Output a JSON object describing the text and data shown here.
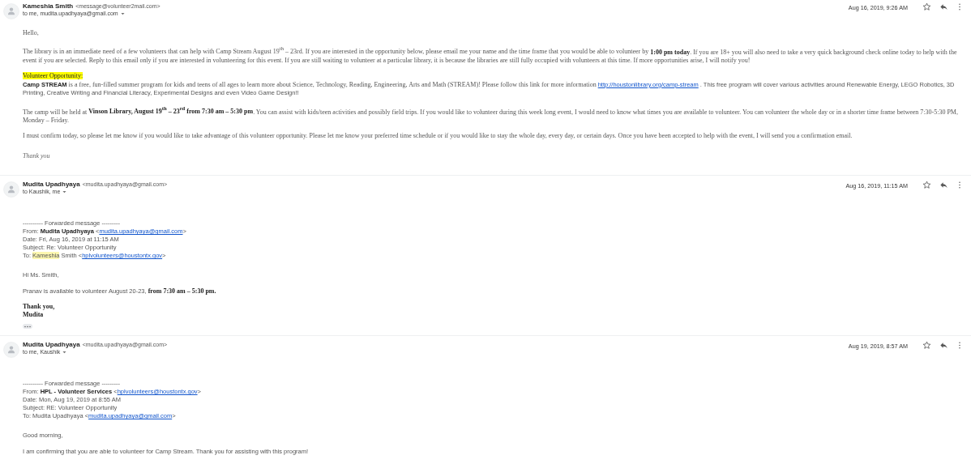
{
  "messages": [
    {
      "sender": "Kameshia Smith",
      "email": "<message@volunteer2mail.com>",
      "to": "to me, mudita.upadhyaya@gmail.com",
      "date": "Aug 16, 2019, 9:26 AM",
      "body": [
        {
          "kind": "para",
          "parts": [
            {
              "kind": "serif",
              "text": "Hello,"
            }
          ]
        },
        {
          "kind": "para",
          "parts": [
            {
              "kind": "serif",
              "text": "The library is in an immediate need of a few volunteers that can help with Camp Stream August 19$^{th}$ – 23rd. If you are interested in the opportunity below, please email me your name and the time frame that you would be able to volunteer by "
            },
            {
              "kind": "serif-strong",
              "text": "1:00 pm today"
            },
            {
              "kind": "serif",
              "text": ". If you are 18+ you will also need to take a very quick background check online today to help with the event if you are selected. Reply to this email only if you are interested in volunteering for this event. If you are still waiting to volunteer at a particular library, it is because the libraries are still fully occupied with volunteers at this time. If more opportunities arise, I will notify you!"
            }
          ]
        },
        {
          "kind": "highlight",
          "parts": [
            {
              "kind": "serif",
              "text": "Volunteer Opportunity:"
            }
          ]
        },
        {
          "kind": "para",
          "parts": [
            {
              "kind": "sans-strong",
              "text": "Camp STREAM"
            },
            {
              "kind": "serif",
              "text": " is a free, fun-filled summer program for kids and teens of all ages to learn more about Science, Technology, Reading, Engineering, Arts and Math (STREAM)! Please follow this link for more information "
            },
            {
              "kind": "link",
              "text": "http://houstonlibrary.org/camp-stream"
            },
            {
              "kind": "sans",
              "text": " . This free program will cover various activities around Renewable Energy, LEGO Robotics, 3D Printing, Creative Writing and Financial Literacy, Experimental Designs and even Video Game Design!!"
            }
          ]
        },
        {
          "kind": "para",
          "parts": [
            {
              "kind": "serif",
              "text": "The camp will be held at "
            },
            {
              "kind": "serif-strong",
              "text": "Vinson Library, August 19$^{th}$ – 23$^{rd}$ from 7:30 am – 5:30 pm"
            },
            {
              "kind": "serif",
              "text": ". You can assist with kids/teen activities and possibly field trips. If you would like to volunteer during this week long event, I would need to know what times you are available to volunteer. You can volunteer the whole day or in a shorter time frame between 7:30-5:30 PM, Monday – Friday."
            }
          ]
        },
        {
          "kind": "para",
          "parts": [
            {
              "kind": "serif",
              "text": "I must confirm today, so please let me know if you would like to take advantage of this volunteer opportunity. Please let me know your preferred time schedule or if you would like to stay the whole day, every day, or certain days. Once you have been accepted to help with the event, I will send you a confirmation email."
            }
          ]
        },
        {
          "kind": "script",
          "parts": [
            {
              "kind": "serif",
              "text": "Thank you"
            }
          ]
        }
      ]
    },
    {
      "sender": "Mudita Upadhyaya",
      "email": "<mudita.upadhyaya@gmail.com>",
      "to": "to Kaushik, me",
      "date": "Aug 16, 2019, 11:15 AM",
      "body": [
        {
          "kind": "line",
          "parts": [
            {
              "kind": "sans",
              "text": "---------- Forwarded message ---------"
            }
          ]
        },
        {
          "kind": "line",
          "parts": [
            {
              "kind": "sans",
              "text": "From: "
            },
            {
              "kind": "sans-strong",
              "text": "Mudita Upadhyaya"
            },
            {
              "kind": "sans",
              "text": " <"
            },
            {
              "kind": "link",
              "text": "mudita.upadhyaya@gmail.com"
            },
            {
              "kind": "sans",
              "text": ">"
            }
          ]
        },
        {
          "kind": "line",
          "parts": [
            {
              "kind": "sans",
              "text": "Date: Fri, Aug 16, 2019 at 11:15 AM"
            }
          ]
        },
        {
          "kind": "line",
          "parts": [
            {
              "kind": "sans",
              "text": "Subject: Re: Volunteer Opportunity"
            }
          ]
        },
        {
          "kind": "line",
          "parts": [
            {
              "kind": "sans",
              "text": "To: "
            },
            {
              "kind": "mark",
              "text": "Kameshia"
            },
            {
              "kind": "sans",
              "text": " Smith <"
            },
            {
              "kind": "link",
              "text": "hplvolunteers@houstontx.gov"
            },
            {
              "kind": "sans",
              "text": ">"
            }
          ]
        },
        {
          "kind": "para",
          "parts": [
            {
              "kind": "sans",
              "text": "Hi Ms. Smith,"
            }
          ]
        },
        {
          "kind": "para",
          "parts": [
            {
              "kind": "sans",
              "text": "Pranav is available to volunteer August 20-23, "
            },
            {
              "kind": "serif-strong",
              "text": "from 7:30 am – 5:30 pm."
            }
          ]
        },
        {
          "kind": "line",
          "parts": [
            {
              "kind": "serif-strong",
              "text": "Thank you,"
            }
          ]
        },
        {
          "kind": "line",
          "parts": [
            {
              "kind": "serif-strong",
              "text": "Mudita"
            }
          ]
        },
        {
          "kind": "trimmed"
        }
      ]
    },
    {
      "sender": "Mudita Upadhyaya",
      "email": "<mudita.upadhyaya@gmail.com>",
      "to": "to me, Kaushik",
      "date": "Aug 19, 2019, 8:57 AM",
      "body": [
        {
          "kind": "line",
          "parts": [
            {
              "kind": "sans",
              "text": "---------- Forwarded message ---------"
            }
          ]
        },
        {
          "kind": "line",
          "parts": [
            {
              "kind": "sans",
              "text": "From: "
            },
            {
              "kind": "sans-strong",
              "text": "HPL - Volunteer Services"
            },
            {
              "kind": "sans",
              "text": " <"
            },
            {
              "kind": "link",
              "text": "hplvolunteers@houstontx.gov"
            },
            {
              "kind": "sans",
              "text": ">"
            }
          ]
        },
        {
          "kind": "line",
          "parts": [
            {
              "kind": "sans",
              "text": "Date: Mon, Aug 19, 2019 at 8:55 AM"
            }
          ]
        },
        {
          "kind": "line",
          "parts": [
            {
              "kind": "sans",
              "text": "Subject: RE: Volunteer Opportunity"
            }
          ]
        },
        {
          "kind": "line",
          "parts": [
            {
              "kind": "sans",
              "text": "To: Mudita Upadhyaya <"
            },
            {
              "kind": "link",
              "text": "mudita.upadhyaya@gmail.com"
            },
            {
              "kind": "sans",
              "text": ">"
            }
          ]
        },
        {
          "kind": "para",
          "parts": [
            {
              "kind": "sans",
              "text": "Good morning,"
            }
          ]
        },
        {
          "kind": "para",
          "parts": [
            {
              "kind": "sans",
              "text": "I am confirming that you are able to volunteer for Camp Stream. Thank you for assisting with this program!"
            }
          ]
        }
      ]
    }
  ]
}
